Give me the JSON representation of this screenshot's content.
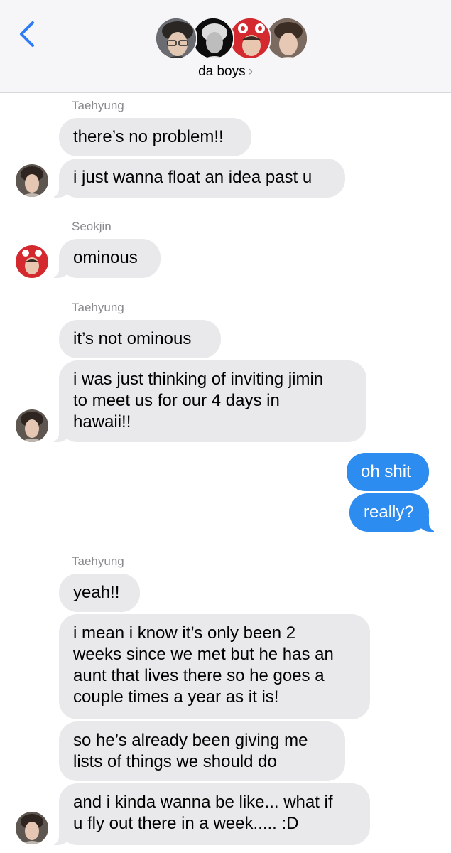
{
  "header": {
    "group_name": "da boys",
    "chevron": "›",
    "back_icon": "chevron-left-icon",
    "accent_color": "#2f7cf6"
  },
  "messages": [
    {
      "sender": "Taehyung"
    },
    {
      "text": "there’s no problem!!"
    },
    {
      "text": "i just wanna float an idea past u"
    },
    {
      "sender": "Seokjin"
    },
    {
      "text": "ominous"
    },
    {
      "sender": "Taehyung"
    },
    {
      "text": "it’s not ominous"
    },
    {
      "lines": [
        "i was just thinking of inviting jimin",
        "to meet us for our 4 days in",
        "hawaii!!"
      ]
    },
    {
      "text": "oh shit"
    },
    {
      "text": "really?"
    },
    {
      "sender": "Taehyung"
    },
    {
      "text": "yeah!!"
    },
    {
      "lines": [
        "i mean i know it’s only been 2",
        "weeks since we met but he has an",
        "aunt that lives there so he goes a",
        "couple times a year as it is!"
      ]
    },
    {
      "lines": [
        "so he’s already been giving me",
        "lists of things we should do"
      ]
    },
    {
      "lines": [
        "and i kinda wanna be like... what if",
        "u fly out there in a week..... :D"
      ]
    }
  ],
  "colors": {
    "received_bubble": "#e9e9eb",
    "sent_bubble": "#2d8cf0",
    "sender_label": "#8a8a8e",
    "header_bg": "#f6f6f8"
  }
}
